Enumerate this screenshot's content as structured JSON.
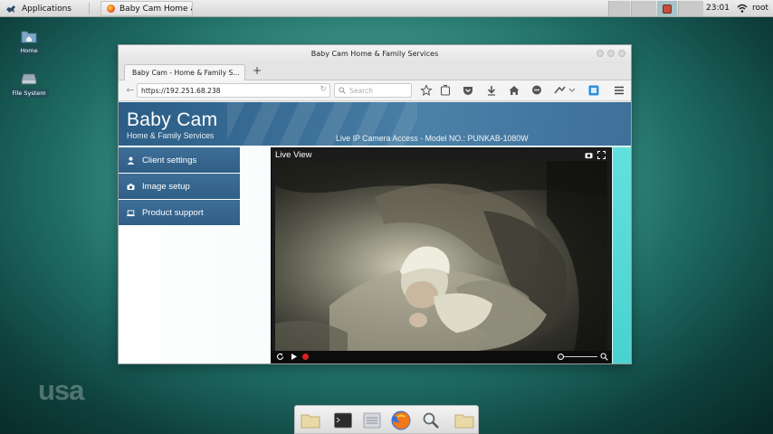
{
  "top_panel": {
    "applications_label": "Applications",
    "task_title": "Baby Cam Home a...",
    "clock": "23:01",
    "user": "root",
    "wifi_icon": "wifi-icon"
  },
  "desktop": {
    "icons": [
      {
        "label": "Home",
        "icon": "folder-home-icon"
      },
      {
        "label": "File System",
        "icon": "drive-icon"
      }
    ]
  },
  "browser": {
    "window_title": "Baby Cam Home & Family Services",
    "tab_title": "Baby Cam - Home & Family S...",
    "new_tab_label": "+",
    "url": "https://192.251.68.238",
    "search_placeholder": "Search"
  },
  "site": {
    "brand_title": "Baby Cam",
    "brand_subtitle": "Home & Family Services",
    "header_info": "Live IP Camera Access  -  Model  NO.:  PUNKAB-1080W",
    "menu": [
      {
        "label": "Client settings",
        "icon": "user-icon"
      },
      {
        "label": "Image setup",
        "icon": "camera-icon"
      },
      {
        "label": "Product support",
        "icon": "laptop-icon"
      }
    ],
    "video": {
      "label": "Live View",
      "zoom_level": 0
    }
  },
  "colors": {
    "header_blue": "#3b6f97",
    "menu_blue": "#2f5e86",
    "cyan_edge": "#49d2d0",
    "record_red": "#d8241c"
  },
  "watermark": {
    "logo": "usa"
  },
  "dock": {
    "items": [
      "folder-icon",
      "terminal-icon",
      "file-manager-icon",
      "firefox-icon",
      "search-icon",
      "folder-icon"
    ]
  }
}
